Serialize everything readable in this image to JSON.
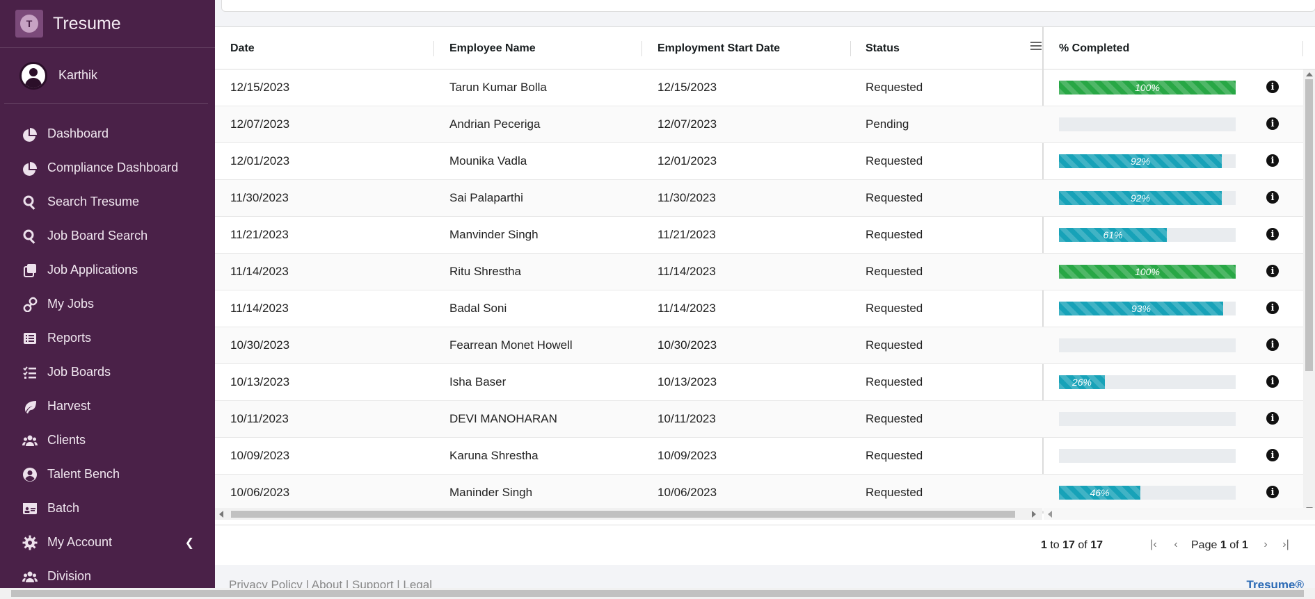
{
  "brand": {
    "name": "Tresume",
    "logo_letter": "T"
  },
  "user": {
    "name": "Karthik"
  },
  "sidebar": {
    "items": [
      {
        "label": "Dashboard",
        "icon": "pie-chart-icon"
      },
      {
        "label": "Compliance Dashboard",
        "icon": "pie-chart-icon"
      },
      {
        "label": "Search Tresume",
        "icon": "search-icon"
      },
      {
        "label": "Job Board Search",
        "icon": "search-icon"
      },
      {
        "label": "Job Applications",
        "icon": "copy-icon"
      },
      {
        "label": "My Jobs",
        "icon": "link-icon"
      },
      {
        "label": "Reports",
        "icon": "list-icon"
      },
      {
        "label": "Job Boards",
        "icon": "checklist-icon"
      },
      {
        "label": "Harvest",
        "icon": "leaf-icon"
      },
      {
        "label": "Clients",
        "icon": "users-icon"
      },
      {
        "label": "Talent Bench",
        "icon": "user-circle-icon"
      },
      {
        "label": "Batch",
        "icon": "id-card-icon"
      },
      {
        "label": "My Account",
        "icon": "gear-icon"
      },
      {
        "label": "Division",
        "icon": "users-icon"
      }
    ]
  },
  "grid": {
    "columns": [
      "Date",
      "Employee Name",
      "Employment Start Date",
      "Status",
      "% Completed"
    ],
    "rows": [
      {
        "date": "12/15/2023",
        "name": "Tarun Kumar Bolla",
        "start": "12/15/2023",
        "status": "Requested",
        "pct": 100,
        "pct_label": "100%"
      },
      {
        "date": "12/07/2023",
        "name": "Andrian Peceriga",
        "start": "12/07/2023",
        "status": "Pending",
        "pct": 0,
        "pct_label": ""
      },
      {
        "date": "12/01/2023",
        "name": "Mounika Vadla",
        "start": "12/01/2023",
        "status": "Requested",
        "pct": 92,
        "pct_label": "92%"
      },
      {
        "date": "11/30/2023",
        "name": "Sai Palaparthi",
        "start": "11/30/2023",
        "status": "Requested",
        "pct": 92,
        "pct_label": "92%"
      },
      {
        "date": "11/21/2023",
        "name": "Manvinder Singh",
        "start": "11/21/2023",
        "status": "Requested",
        "pct": 61,
        "pct_label": "61%"
      },
      {
        "date": "11/14/2023",
        "name": "Ritu Shrestha",
        "start": "11/14/2023",
        "status": "Requested",
        "pct": 100,
        "pct_label": "100%"
      },
      {
        "date": "11/14/2023",
        "name": "Badal Soni",
        "start": "11/14/2023",
        "status": "Requested",
        "pct": 93,
        "pct_label": "93%"
      },
      {
        "date": "10/30/2023",
        "name": "Fearrean Monet Howell",
        "start": "10/30/2023",
        "status": "Requested",
        "pct": 0,
        "pct_label": ""
      },
      {
        "date": "10/13/2023",
        "name": "Isha Baser",
        "start": "10/13/2023",
        "status": "Requested",
        "pct": 26,
        "pct_label": "26%"
      },
      {
        "date": "10/11/2023",
        "name": "DEVI MANOHARAN",
        "start": "10/11/2023",
        "status": "Requested",
        "pct": 0,
        "pct_label": ""
      },
      {
        "date": "10/09/2023",
        "name": "Karuna Shrestha",
        "start": "10/09/2023",
        "status": "Requested",
        "pct": 0,
        "pct_label": ""
      },
      {
        "date": "10/06/2023",
        "name": "Maninder Singh",
        "start": "10/06/2023",
        "status": "Requested",
        "pct": 46,
        "pct_label": "46%"
      }
    ]
  },
  "pagination": {
    "from": "1",
    "to_word": "to",
    "to": "17",
    "of_word": "of",
    "total": "17",
    "page_word": "Page",
    "page": "1",
    "pages": "1"
  },
  "footer": {
    "links": "Privacy Policy | About | Support | Legal",
    "brand": "Tresume®"
  },
  "colors": {
    "sidebar": "#4a2148",
    "complete": "#28a745",
    "progress": "#17a2b8"
  }
}
